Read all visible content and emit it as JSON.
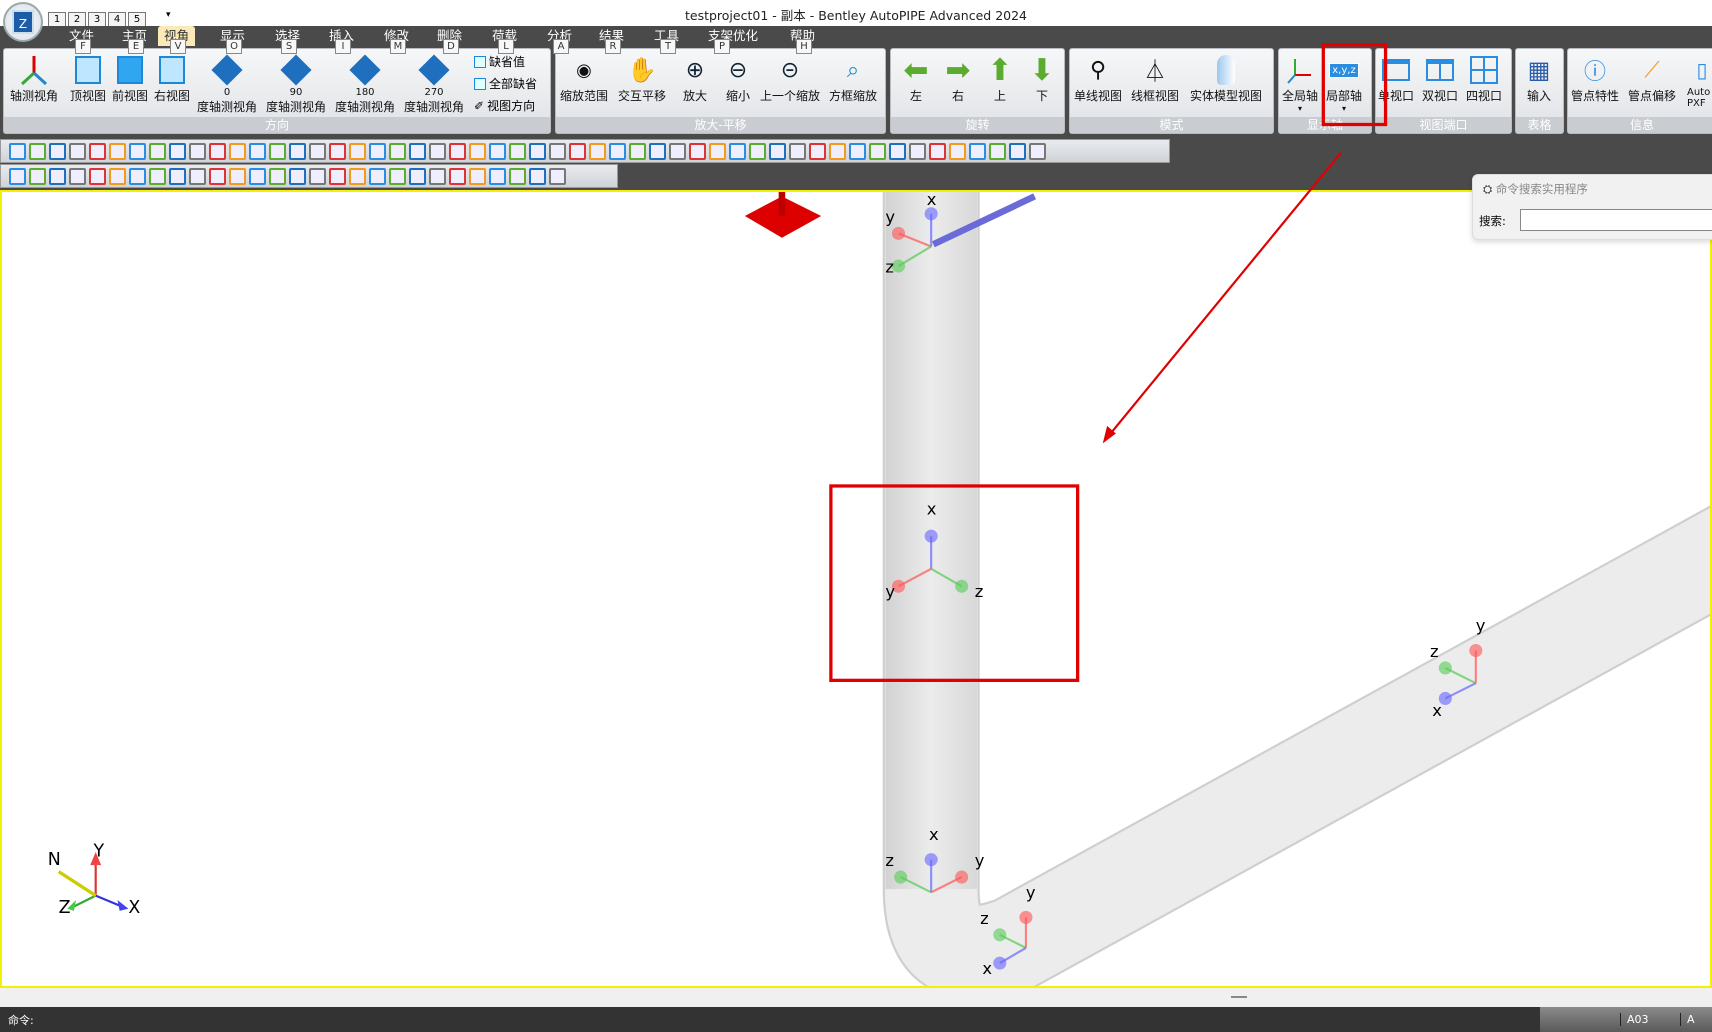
{
  "window": {
    "title": "testproject01 - 副本 - Bentley AutoPIPE Advanced 2024",
    "app_icon_letter": "Z"
  },
  "qat": {
    "keytips": [
      "1",
      "2",
      "3",
      "4",
      "5"
    ]
  },
  "tabs": [
    {
      "label": "文件",
      "key": "F"
    },
    {
      "label": "主页",
      "key": "E"
    },
    {
      "label": "视角",
      "key": "V",
      "active": true
    },
    {
      "label": "显示",
      "key": "O"
    },
    {
      "label": "选择",
      "key": "S"
    },
    {
      "label": "插入",
      "key": "I"
    },
    {
      "label": "修改",
      "key": "M"
    },
    {
      "label": "删除",
      "key": "D"
    },
    {
      "label": "荷载",
      "key": "L"
    },
    {
      "label": "分析",
      "key": "A"
    },
    {
      "label": "结果",
      "key": "R"
    },
    {
      "label": "工具",
      "key": "T"
    },
    {
      "label": "支架优化",
      "key": "P"
    },
    {
      "label": "帮助",
      "key": "H"
    }
  ],
  "ribbon": {
    "direction": {
      "label": "方向",
      "buttons": [
        "轴测视角",
        "顶视图",
        "前视图",
        "右视图"
      ],
      "iso": [
        {
          "deg": "0",
          "label": "度轴测视角"
        },
        {
          "deg": "90",
          "label": "度轴测视角"
        },
        {
          "deg": "180",
          "label": "度轴测视角"
        },
        {
          "deg": "270",
          "label": "度轴测视角"
        }
      ],
      "small": [
        "缺省值",
        "全部缺省",
        "视图方向"
      ]
    },
    "zoom_pan": {
      "label": "放大-平移",
      "buttons": [
        "缩放范围",
        "交互平移",
        "放大",
        "缩小",
        "上一个缩放",
        "方框缩放"
      ]
    },
    "rotate": {
      "label": "旋转",
      "buttons": [
        "左",
        "右",
        "上",
        "下"
      ]
    },
    "mode": {
      "label": "模式",
      "buttons": [
        "单线视图",
        "线框视图",
        "实体模型视图"
      ]
    },
    "axes": {
      "label": "显示轴",
      "buttons": [
        "全局轴",
        "局部轴"
      ],
      "local_icon_text": "x,y,z"
    },
    "viewport": {
      "label": "视图端口",
      "buttons": [
        "单视口",
        "双视口",
        "四视口"
      ]
    },
    "table": {
      "label": "表格",
      "buttons": [
        "输入"
      ]
    },
    "info": {
      "label": "信息",
      "buttons": [
        "管点特性",
        "管点偏移",
        "Auto PXF"
      ]
    }
  },
  "search_panel": {
    "title": "命令搜索实用程序",
    "label": "搜索:",
    "value": ""
  },
  "compass": {
    "labels": [
      "N",
      "Y",
      "Z",
      "X"
    ]
  },
  "triads": {
    "x": "x",
    "y": "y",
    "z": "z"
  },
  "command": {
    "label": "命令:"
  },
  "status": {
    "cells": [
      "A03",
      "A"
    ]
  },
  "colors": {
    "annotation": "#e00000",
    "viewport_border": "#f5f000"
  }
}
